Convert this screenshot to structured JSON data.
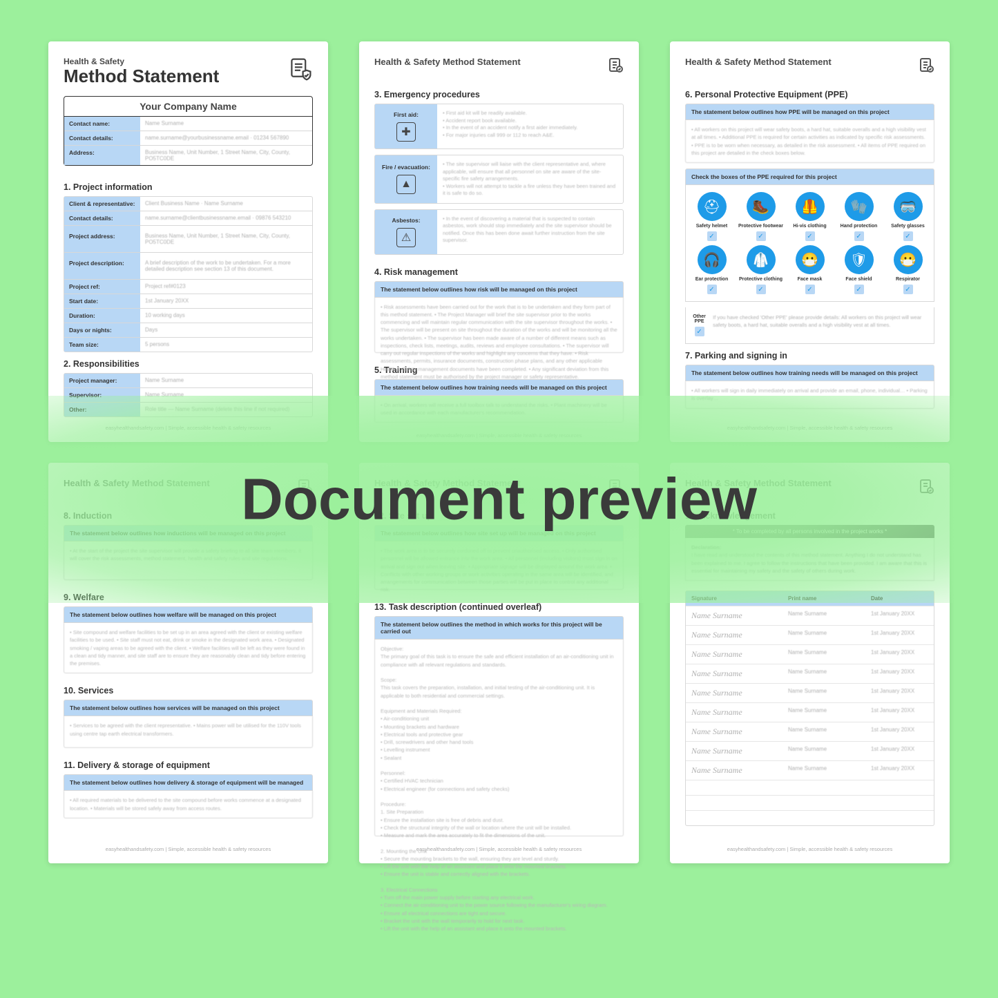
{
  "overlay": "Document preview",
  "footer": "easyhealthandsafety.com  |  Simple, accessible health & safety resources",
  "header_runner": "Health & Safety Method Statement",
  "p1": {
    "pretitle": "Health & Safety",
    "title": "Method Statement",
    "company_title": "Your Company Name",
    "company_rows": [
      {
        "l": "Contact name:",
        "v": "Name Surname"
      },
      {
        "l": "Contact details:",
        "v": "name.surname@yourbusinessname.email · 01234 567890"
      },
      {
        "l": "Address:",
        "v": "Business Name, Unit Number, 1 Street Name, City, County, PO5TC0DE"
      }
    ],
    "s1": "1. Project information",
    "proj_rows": [
      {
        "l": "Client & representative:",
        "v": "Client Business Name · Name Surname"
      },
      {
        "l": "Contact details:",
        "v": "name.surname@clientbusinessname.email · 09876 543210"
      },
      {
        "l": "Project address:",
        "v": "Business Name, Unit Number, 1 Street Name, City, County, PO5TC0DE",
        "tall": true
      },
      {
        "l": "Project description:",
        "v": "A brief description of the work to be undertaken. For a more detailed description see section 13 of this document.",
        "tall": true
      },
      {
        "l": "Project ref:",
        "v": "Project ref#0123"
      },
      {
        "l": "Start date:",
        "v": "1st January 20XX"
      },
      {
        "l": "Duration:",
        "v": "10 working days"
      },
      {
        "l": "Days or nights:",
        "v": "Days"
      },
      {
        "l": "Team size:",
        "v": "5 persons"
      }
    ],
    "s2": "2. Responsibilities",
    "resp_rows": [
      {
        "l": "Project manager:",
        "v": "Name Surname"
      },
      {
        "l": "Supervisor:",
        "v": "Name Surname"
      },
      {
        "l": "Other:",
        "v": "Role title — Name Surname (delete this line if not required)"
      }
    ]
  },
  "p2": {
    "s3": "3. Emergency procedures",
    "emerg": [
      {
        "l": "First aid:",
        "txt": "• First aid kit will be readily available.\n• Accident report book available.\n• In the event of an accident notify a first aider immediately.\n• For major injuries call 999 or 112 to reach A&E."
      },
      {
        "l": "Fire / evacuation:",
        "txt": "• The site supervisor will liaise with the client representative and, where applicable, will ensure that all personnel on site are aware of the site-specific fire safety arrangements.\n• Workers will not attempt to tackle a fire unless they have been trained and it is safe to do so."
      },
      {
        "l": "Asbestos:",
        "txt": "• In the event of discovering a material that is suspected to contain asbestos, work should stop immediately and the site supervisor should be notified. Once this has been done await further instruction from the site supervisor."
      }
    ],
    "s4": "4. Risk management",
    "band4": "The statement below outlines how risk will be managed on this project",
    "box4": "• Risk assessments have been carried out for the work that is to be undertaken and they form part of this method statement.\n• The Project Manager will brief the site supervisor prior to the works commencing and will maintain regular communication with the site supervisor throughout the works.\n• The supervisor will be present on site throughout the duration of the works and will be monitoring all the works undertaken.\n• The supervisor has been made aware of a number of different means such as inspections, check lists, meetings, audits, reviews and employee consultations.\n• The supervisor will carry out regular inspections of the works and highlight any concerns that they have.\n• Risk assessments, permits, insurance documents, construction phase plans, and any other applicable Health & Safety management documents have been completed.\n• Any significant deviation from this method statement must be authorised by the project manager or safety representative.",
    "s5": "5. Training",
    "band5": "The statement below outlines how training needs will be managed on this project",
    "box5": "• On arrival, workers will receive a full toolbox talk to understand the risks.\n• Plant machinery will be used in accordance with each manufacturer's recommendation."
  },
  "p3": {
    "s6": "6. Personal Protective Equipment (PPE)",
    "band6a": "The statement below outlines how PPE will be managed on this project",
    "box6a": "• All workers on this project will wear safety boots, a hard hat, suitable overalls and a high visibility vest at all times.\n• Additional PPE is required for certain activities as indicated by specific risk assessments.\n• PPE is to be worn when necessary, as detailed in the risk assessment.\n• All items of PPE required on this project are detailed in the check boxes below.",
    "band6b": "Check the boxes of the PPE required for this project",
    "ppe": [
      "Safety helmet",
      "Protective footwear",
      "Hi-vis clothing",
      "Hand protection",
      "Safety glasses",
      "Ear protection",
      "Protective clothing",
      "Face mask",
      "Face shield",
      "Respirator"
    ],
    "other_l": "Other PPE",
    "other_v": "If you have checked 'Other PPE' please provide details:\nAll workers on this project will wear safety boots, a hard hat, suitable overalls and a high visibility vest at all times.",
    "s7": "7. Parking and signing in",
    "band7": "The statement below outlines how training needs will be managed on this project",
    "box7": "• All workers will sign in daily immediately on arrival and provide an email, phone, individual…\n• Parking is overlay…"
  },
  "p4": {
    "s8": "8. Induction",
    "band8": "The statement below outlines how inductions will be managed on this project",
    "box8": "• At the start of the project the site supervisor will provide a safety briefing to all site team members. It will cover the risk assessments, method statement, health and safety rules and site regulations.",
    "s9": "9. Welfare",
    "band9": "The statement below outlines how welfare will be managed on this project",
    "box9": "• Site compound and welfare facilities to be set up in an area agreed with the client or existing welfare facilities to be used.\n• Site staff must not eat, drink or smoke in the designated work area.\n• Designated smoking / vaping areas to be agreed with the client.\n• Welfare facilities will be left as they were found in a clean and tidy manner, and site staff are to ensure they are reasonably clean and tidy before entering the premises.",
    "s10": "10. Services",
    "band10": "The statement below outlines how services will be managed on this project",
    "box10": "• Services to be agreed with the client representative.\n• Mains power will be utilised for the 110V tools using centre tap earth electrical transformers.",
    "s11": "11. Delivery & storage of equipment",
    "band11": "The statement below outlines how delivery & storage of equipment will be managed",
    "box11": "• All required materials to be delivered to the site compound before works commence at a designated location.\n• Materials will be stored safely away from access routes."
  },
  "p5": {
    "s12": "12. Site set up",
    "band12": "The statement below outlines how site set up will be managed on this project",
    "box12": "• The work area is to be securely cordoned off to prevent unauthorised access.\n• Only authorised personnel will be allowed entrance into the work area.\n• All personnel (including visitors) must sign in on arrival and sign out when leaving site.\n• Appropriate signage will be displayed around the work area.\n• Conflicts with other working groups or work activities operating in the same area will be identified, and arrangements for communication between those parties will be put in place to control any additional risk.",
    "s13": "13. Task description (continued overleaf)",
    "band13": "The statement below outlines the method in which works for this project will be carried out",
    "box13": "Objective:\nThe primary goal of this task is to ensure the safe and efficient installation of an air-conditioning unit in compliance with all relevant regulations and standards.\n\nScope:\nThis task covers the preparation, installation, and initial testing of the air-conditioning unit. It is applicable to both residential and commercial settings.\n\nEquipment and Materials Required:\n• Air-conditioning unit\n• Mounting brackets and hardware\n• Electrical tools and protective gear\n• Drill, screwdrivers and other hand tools\n• Levelling instrument\n• Sealant\n\nPersonnel:\n• Certified HVAC technician\n• Electrical engineer (for connections and safety checks)\n\nProcedure:\n1. Site Preparation\n  • Ensure the installation site is free of debris and dust.\n  • Check the structural integrity of the wall or location where the unit will be installed.\n  • Measure and mark the area accurately to fit the dimensions of the unit.\n\n2. Mounting the Unit\n  • Secure the mounting brackets to the wall, ensuring they are level and sturdy.\n  • Lift the unit with the help of an assistant and place it onto the mounted brackets.\n  • Ensure the unit is stable and correctly aligned with the brackets.\n\n3. Electrical Connections\n  • Turn off the main power supply before starting any electrical work.\n  • Connect the air-conditioning unit to the power source following the manufacturer's wiring diagram.\n  • Ensure all electrical connections are tight and secure.\n  • Bracket the unit with the wall temporarily to hold for next task.\n  • Lift the unit with the help of an assistant and place it onto the mounted brackets."
  },
  "p6": {
    "s14": "14. Acknowledgement",
    "decl_bar": "* To be completed by all persons involved in the project works *",
    "decl_l": "Declaration:",
    "decl": "I have read and understood the contents of this method statement. Anything I do not understand has been explained to me. I agree to follow the instructions that have been provided. I am aware that this is essential for maintaining my safety and the safety of others during work.",
    "sig_head": [
      "Signature",
      "Print name",
      "Date"
    ],
    "sig_rows": [
      {
        "s": "Name Surname",
        "n": "Name Surname",
        "d": "1st January 20XX"
      },
      {
        "s": "Name Surname",
        "n": "Name Surname",
        "d": "1st January 20XX"
      },
      {
        "s": "Name Surname",
        "n": "Name Surname",
        "d": "1st January 20XX"
      },
      {
        "s": "Name Surname",
        "n": "Name Surname",
        "d": "1st January 20XX"
      },
      {
        "s": "Name Surname",
        "n": "Name Surname",
        "d": "1st January 20XX"
      },
      {
        "s": "Name Surname",
        "n": "Name Surname",
        "d": "1st January 20XX"
      },
      {
        "s": "Name Surname",
        "n": "Name Surname",
        "d": "1st January 20XX"
      },
      {
        "s": "Name Surname",
        "n": "Name Surname",
        "d": "1st January 20XX"
      },
      {
        "s": "Name Surname",
        "n": "Name Surname",
        "d": "1st January 20XX"
      }
    ]
  }
}
